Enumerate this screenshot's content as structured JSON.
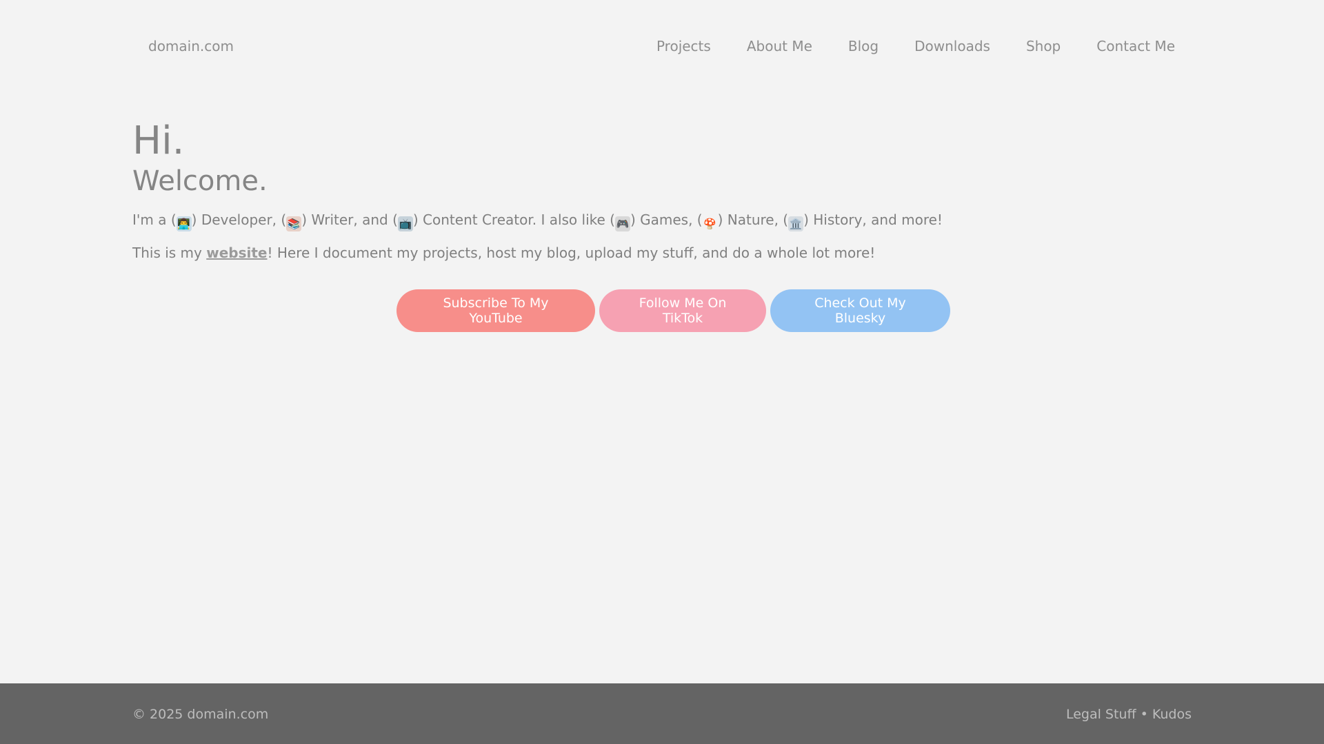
{
  "header": {
    "brand": "domain.com",
    "nav": [
      "Projects",
      "About Me",
      "Blog",
      "Downloads",
      "Shop",
      "Contact Me"
    ]
  },
  "main": {
    "greeting": "Hi.",
    "welcome": "Welcome.",
    "intro": {
      "prefix": "I'm a (",
      "dev_emoji": "👨‍💻",
      "dev": ") Developer, (",
      "writer_emoji": "📚",
      "writer": ") Writer, and (",
      "tv_emoji": "📺",
      "creator": ") Content Creator. I also like (",
      "game_emoji": "🎮",
      "games": ") Games, (",
      "nature_emoji": "🍄",
      "nature": ") Nature, (",
      "history_emoji": "🏛️",
      "history": ") History, and more!"
    },
    "desc": {
      "prefix": "This is my ",
      "link": "website",
      "suffix": "! Here I document my projects, host my blog, upload my stuff, and do a whole lot more!"
    }
  },
  "cta": {
    "youtube": "Subscribe To My YouTube",
    "tiktok": "Follow Me On TikTok",
    "bluesky": "Check Out My Bluesky"
  },
  "footer": {
    "copyright": "© 2025 domain.com",
    "legal": "Legal Stuff",
    "separator": " • ",
    "kudos": "Kudos"
  },
  "colors": {
    "background": "#f3f3f3",
    "footer": "#646464",
    "youtube": "#f78e8a",
    "tiktok": "#f6a1b2",
    "bluesky": "#93c3f3"
  }
}
